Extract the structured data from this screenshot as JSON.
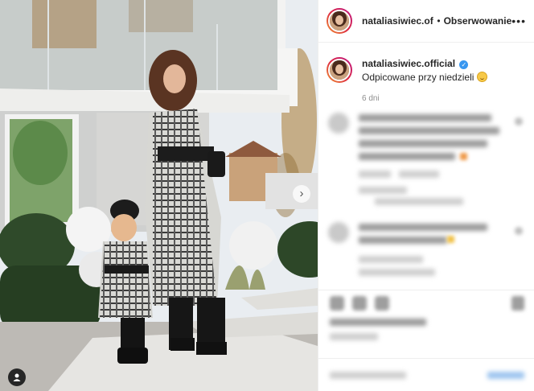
{
  "post": {
    "username": "nataliasiwiec.offici",
    "separator": "•",
    "follow_label": "Obserwowanie",
    "more_icon": "more-horizontal-icon",
    "caption_username": "nataliasiwiec.official",
    "caption_text": "Odpicowane przy niedzieli",
    "caption_emoji": "grinning-emoji",
    "time_ago": "6 dni"
  },
  "photo": {
    "user_tag_icon": "user-tag-icon",
    "next_icon": "chevron-right-icon"
  },
  "colors": {
    "verified": "#3897f0",
    "text": "#262626",
    "muted": "#8e8e8e",
    "divider": "#efefef"
  }
}
